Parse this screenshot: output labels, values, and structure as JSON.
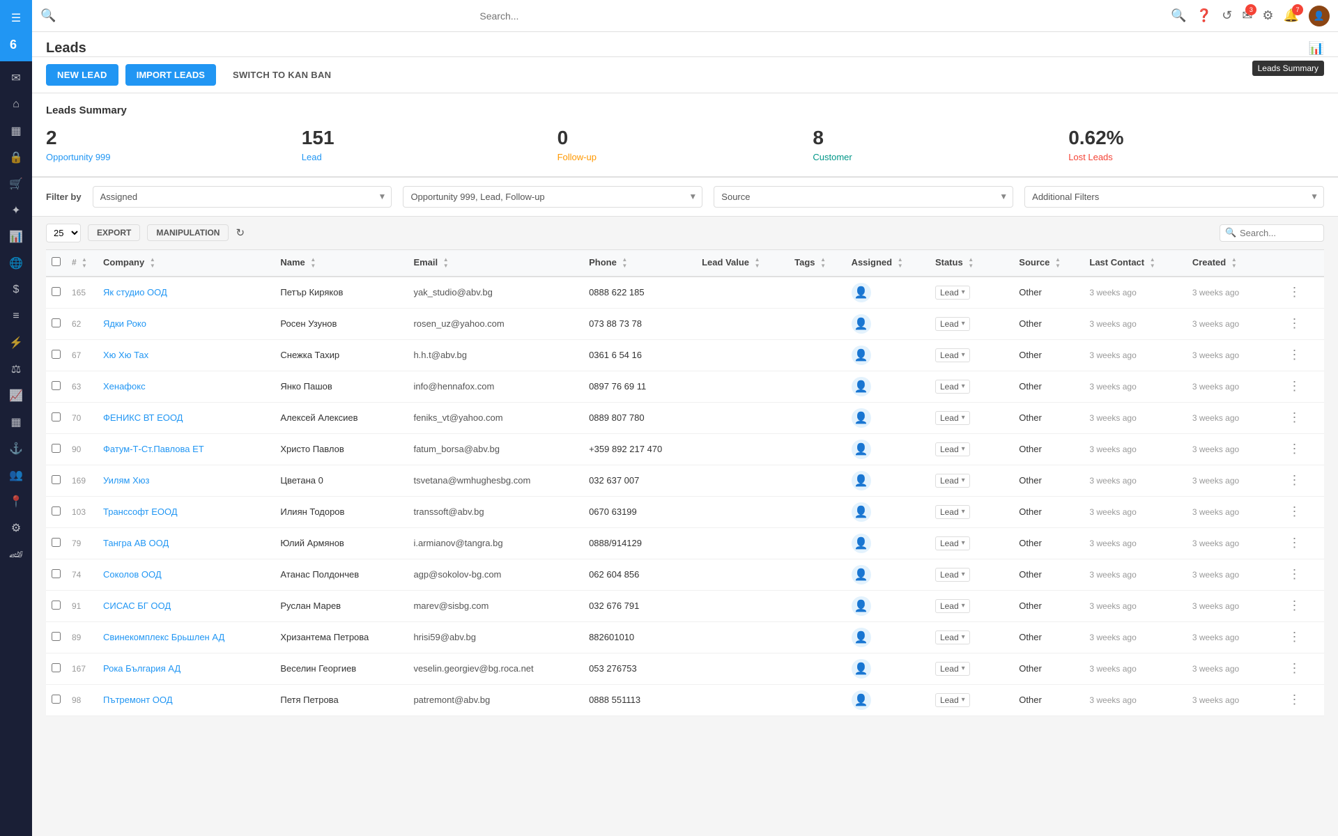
{
  "sidebar": {
    "logo_text": "6",
    "icons": [
      {
        "name": "menu-icon",
        "symbol": "☰"
      },
      {
        "name": "email-icon",
        "symbol": "✉"
      },
      {
        "name": "home-icon",
        "symbol": "⌂"
      },
      {
        "name": "calendar-icon",
        "symbol": "📅"
      },
      {
        "name": "lock-icon",
        "symbol": "🔒"
      },
      {
        "name": "cart-icon",
        "symbol": "🛒"
      },
      {
        "name": "star-icon",
        "symbol": "✦"
      },
      {
        "name": "chart-icon",
        "symbol": "📊"
      },
      {
        "name": "globe-icon",
        "symbol": "🌐"
      },
      {
        "name": "dollar-icon",
        "symbol": "$"
      },
      {
        "name": "list-icon",
        "symbol": "☰"
      },
      {
        "name": "filter-icon",
        "symbol": "⚡"
      },
      {
        "name": "scale-icon",
        "symbol": "⚖"
      },
      {
        "name": "graph-icon",
        "symbol": "📈"
      },
      {
        "name": "grid-icon",
        "symbol": "▦"
      },
      {
        "name": "anchor-icon",
        "symbol": "⚓"
      },
      {
        "name": "people-icon",
        "symbol": "👥"
      },
      {
        "name": "location-icon",
        "symbol": "📍"
      },
      {
        "name": "settings2-icon",
        "symbol": "⚙"
      },
      {
        "name": "speedometer-icon",
        "symbol": "🏎"
      }
    ]
  },
  "topnav": {
    "search_placeholder": "Search...",
    "badge_notifications": "7",
    "badge_messages": "3"
  },
  "page": {
    "title": "Leads",
    "leads_summary_tooltip": "Leads Summary"
  },
  "toolbar": {
    "new_lead_label": "NEW LEAD",
    "import_leads_label": "IMPORT LEADS",
    "switch_kanban_label": "SWITCH TO KAN BAN"
  },
  "summary": {
    "title": "Leads Summary",
    "cards": [
      {
        "number": "2",
        "label": "Opportunity 999",
        "color": "blue"
      },
      {
        "number": "151",
        "label": "Lead",
        "color": "blue"
      },
      {
        "number": "0",
        "label": "Follow-up",
        "color": "orange"
      },
      {
        "number": "8",
        "label": "Customer",
        "color": "teal"
      },
      {
        "number": "0.62%",
        "label": "Lost Leads",
        "color": "red"
      }
    ]
  },
  "filters": {
    "label": "Filter by",
    "filter1": {
      "value": "Assigned",
      "placeholder": "Assigned"
    },
    "filter2": {
      "value": "Opportunity 999, Lead, Follow-up",
      "placeholder": "Opportunity 999, Lead, Follow-up"
    },
    "filter3": {
      "value": "Source",
      "placeholder": "Source"
    },
    "filter4": {
      "value": "Additional Filters",
      "placeholder": "Additional Filters"
    }
  },
  "table_toolbar": {
    "per_page": "25",
    "export_label": "EXPORT",
    "manipulation_label": "MANIPULATION",
    "search_placeholder": "Search..."
  },
  "table": {
    "columns": [
      {
        "key": "id",
        "label": "#"
      },
      {
        "key": "company",
        "label": "Company"
      },
      {
        "key": "name",
        "label": "Name"
      },
      {
        "key": "email",
        "label": "Email"
      },
      {
        "key": "phone",
        "label": "Phone"
      },
      {
        "key": "lead_value",
        "label": "Lead Value"
      },
      {
        "key": "tags",
        "label": "Tags"
      },
      {
        "key": "assigned",
        "label": "Assigned"
      },
      {
        "key": "status",
        "label": "Status"
      },
      {
        "key": "source",
        "label": "Source"
      },
      {
        "key": "last_contact",
        "label": "Last Contact"
      },
      {
        "key": "created",
        "label": "Created"
      }
    ],
    "rows": [
      {
        "id": "165",
        "company": "Як студио ООД",
        "name": "Петър Киряков",
        "email": "yak_studio@abv.bg",
        "phone": "0888 622 185",
        "lead_value": "",
        "tags": "",
        "assigned": "",
        "status": "Lead",
        "source": "Other",
        "last_contact": "3 weeks ago",
        "created": "3 weeks ago"
      },
      {
        "id": "62",
        "company": "Ядки Роко",
        "name": "Росен Узунов",
        "email": "rosen_uz@yahoo.com",
        "phone": "073 88 73 78",
        "lead_value": "",
        "tags": "",
        "assigned": "",
        "status": "Lead",
        "source": "Other",
        "last_contact": "3 weeks ago",
        "created": "3 weeks ago"
      },
      {
        "id": "67",
        "company": "Хю Хю Тах",
        "name": "Снежка Тахир",
        "email": "h.h.t@abv.bg",
        "phone": "0361 6 54 16",
        "lead_value": "",
        "tags": "",
        "assigned": "",
        "status": "Lead",
        "source": "Other",
        "last_contact": "3 weeks ago",
        "created": "3 weeks ago"
      },
      {
        "id": "63",
        "company": "Хенафокс",
        "name": "Янко Пашов",
        "email": "info@hennafox.com",
        "phone": "0897 76 69 11",
        "lead_value": "",
        "tags": "",
        "assigned": "",
        "status": "Lead",
        "source": "Other",
        "last_contact": "3 weeks ago",
        "created": "3 weeks ago"
      },
      {
        "id": "70",
        "company": "ФЕНИКС ВТ ЕООД",
        "name": "Алексей Алексиев",
        "email": "feniks_vt@yahoo.com",
        "phone": "0889 807 780",
        "lead_value": "",
        "tags": "",
        "assigned": "",
        "status": "Lead",
        "source": "Other",
        "last_contact": "3 weeks ago",
        "created": "3 weeks ago"
      },
      {
        "id": "90",
        "company": "Фатум-Т-Ст.Павлова ЕТ",
        "name": "Христо Павлов",
        "email": "fatum_borsa@abv.bg",
        "phone": "+359 892 217 470",
        "lead_value": "",
        "tags": "",
        "assigned": "",
        "status": "Lead",
        "source": "Other",
        "last_contact": "3 weeks ago",
        "created": "3 weeks ago"
      },
      {
        "id": "169",
        "company": "Уилям Хюз",
        "name": "Цветана 0",
        "email": "tsvetana@wmhughesbg.com",
        "phone": "032 637 007",
        "lead_value": "",
        "tags": "",
        "assigned": "",
        "status": "Lead",
        "source": "Other",
        "last_contact": "3 weeks ago",
        "created": "3 weeks ago"
      },
      {
        "id": "103",
        "company": "Транссофт ЕООД",
        "name": "Илиян Тодоров",
        "email": "transsoft@abv.bg",
        "phone": "0670 63199",
        "lead_value": "",
        "tags": "",
        "assigned": "",
        "status": "Lead",
        "source": "Other",
        "last_contact": "3 weeks ago",
        "created": "3 weeks ago"
      },
      {
        "id": "79",
        "company": "Тангра АВ ООД",
        "name": "Юлий Армянов",
        "email": "i.armianov@tangra.bg",
        "phone": "0888/914129",
        "lead_value": "",
        "tags": "",
        "assigned": "",
        "status": "Lead",
        "source": "Other",
        "last_contact": "3 weeks ago",
        "created": "3 weeks ago"
      },
      {
        "id": "74",
        "company": "Соколов ООД",
        "name": "Атанас Полдончев",
        "email": "agp@sokolov-bg.com",
        "phone": "062 604 856",
        "lead_value": "",
        "tags": "",
        "assigned": "",
        "status": "Lead",
        "source": "Other",
        "last_contact": "3 weeks ago",
        "created": "3 weeks ago"
      },
      {
        "id": "91",
        "company": "СИСАС БГ ООД",
        "name": "Руслан Марев",
        "email": "marev@sisbg.com",
        "phone": "032 676 791",
        "lead_value": "",
        "tags": "",
        "assigned": "",
        "status": "Lead",
        "source": "Other",
        "last_contact": "3 weeks ago",
        "created": "3 weeks ago"
      },
      {
        "id": "89",
        "company": "Свинекомплекс Брьшлен АД",
        "name": "Хризантема Петрова",
        "email": "hrisi59@abv.bg",
        "phone": "882601010",
        "lead_value": "",
        "tags": "",
        "assigned": "",
        "status": "Lead",
        "source": "Other",
        "last_contact": "3 weeks ago",
        "created": "3 weeks ago"
      },
      {
        "id": "167",
        "company": "Рока България АД",
        "name": "Веселин Георгиев",
        "email": "veselin.georgiev@bg.roca.net",
        "phone": "053 276753",
        "lead_value": "",
        "tags": "",
        "assigned": "",
        "status": "Lead",
        "source": "Other",
        "last_contact": "3 weeks ago",
        "created": "3 weeks ago"
      },
      {
        "id": "98",
        "company": "Пътремонт ООД",
        "name": "Петя Петрова",
        "email": "patremont@abv.bg",
        "phone": "0888 551113",
        "lead_value": "",
        "tags": "",
        "assigned": "",
        "status": "Lead",
        "source": "Other",
        "last_contact": "3 weeks ago",
        "created": "3 weeks ago"
      }
    ]
  }
}
